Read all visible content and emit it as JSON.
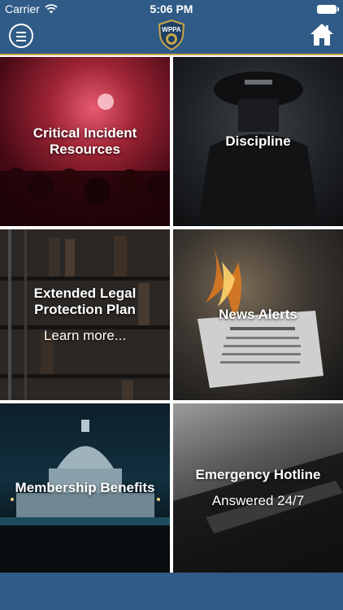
{
  "status_bar": {
    "carrier": "Carrier",
    "time": "5:06 PM"
  },
  "nav": {
    "logo_text": "WPPA",
    "menu_icon": "hamburger-menu-icon",
    "home_icon": "house-icon"
  },
  "colors": {
    "bar": "#2f5b86",
    "accent_gold": "#c9a64a"
  },
  "tiles": [
    {
      "title_line1": "Critical Incident",
      "title_line2": "Resources",
      "subtitle": ""
    },
    {
      "title_line1": "Discipline",
      "title_line2": "",
      "subtitle": ""
    },
    {
      "title_line1": "Extended Legal",
      "title_line2": "Protection Plan",
      "subtitle": "Learn more..."
    },
    {
      "title_line1": "News Alerts",
      "title_line2": "",
      "subtitle": ""
    },
    {
      "title_line1": "Membership Benefits",
      "title_line2": "",
      "subtitle": ""
    },
    {
      "title_line1": "Emergency Hotline",
      "title_line2": "",
      "subtitle": "Answered 24/7"
    }
  ]
}
